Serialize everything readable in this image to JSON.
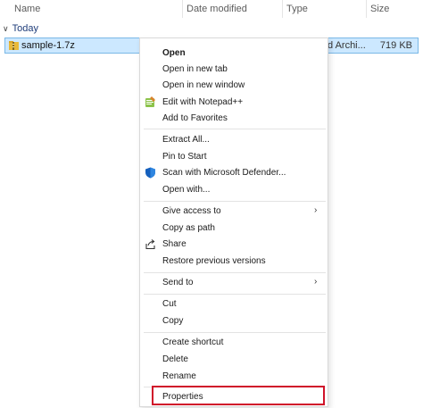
{
  "columns": {
    "name": "Name",
    "date_modified": "Date modified",
    "type": "Type",
    "size": "Size"
  },
  "group": {
    "label": "Today",
    "chevron": "∨"
  },
  "file": {
    "name": "sample-1.7z",
    "type_partial": "d Archi...",
    "size": "719 KB",
    "icon": "archive-folder-icon"
  },
  "menu": {
    "open": "Open",
    "open_new_tab": "Open in new tab",
    "open_new_window": "Open in new window",
    "edit_notepad": "Edit with Notepad++",
    "add_favorites": "Add to Favorites",
    "extract_all": "Extract All...",
    "pin_start": "Pin to Start",
    "scan_defender": "Scan with Microsoft Defender...",
    "open_with": "Open with...",
    "give_access": "Give access to",
    "copy_path": "Copy as path",
    "share": "Share",
    "restore_versions": "Restore previous versions",
    "send_to": "Send to",
    "cut": "Cut",
    "copy": "Copy",
    "create_shortcut": "Create shortcut",
    "delete": "Delete",
    "rename": "Rename",
    "properties": "Properties",
    "submenu_arrow": "›"
  },
  "colors": {
    "selection_bg": "#cce8ff",
    "selection_border": "#7ab8e6",
    "highlight": "#d0132a",
    "defender_blue": "#1560bd",
    "notepad_green": "#5aa02c"
  }
}
